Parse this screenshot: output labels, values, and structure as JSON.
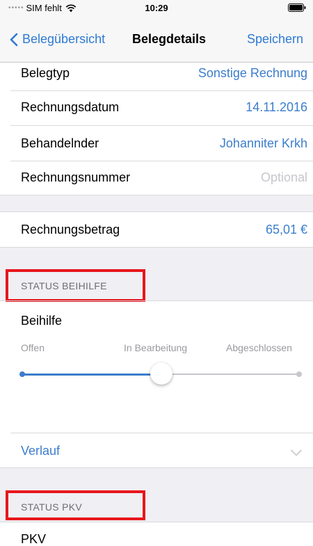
{
  "status_bar": {
    "carrier": "SIM fehlt",
    "signal_dots": "•••••",
    "time": "10:29",
    "wifi_icon": "wifi-icon",
    "battery_icon": "battery-icon"
  },
  "nav": {
    "back_label": "Belegübersicht",
    "title": "Belegdetails",
    "save_label": "Speichern",
    "back_icon": "chevron-left-icon"
  },
  "rows": {
    "belegtyp": {
      "label": "Belegtyp",
      "value": "Sonstige Rechnung"
    },
    "datum": {
      "label": "Rechnungsdatum",
      "value": "14.11.2016"
    },
    "behandelnder": {
      "label": "Behandelnder",
      "value": "Johanniter Krkh"
    },
    "nummer": {
      "label": "Rechnungsnummer",
      "placeholder": "Optional"
    },
    "betrag": {
      "label": "Rechnungsbetrag",
      "value": "65,01 €"
    }
  },
  "beihilfe": {
    "header": "STATUS BEIHILFE",
    "label": "Beihilfe",
    "slider": {
      "options": [
        "Offen",
        "In Bearbeitung",
        "Abgeschlossen"
      ],
      "selected": "In Bearbeitung",
      "position_fraction": 0.5
    },
    "verlauf_label": "Verlauf",
    "verlauf_icon": "chevron-down-icon"
  },
  "pkv": {
    "header": "STATUS PKV",
    "label": "PKV"
  },
  "colors": {
    "accent": "#3c7dcc",
    "highlight_box": "#e8161c",
    "group_background": "#efeff4"
  }
}
